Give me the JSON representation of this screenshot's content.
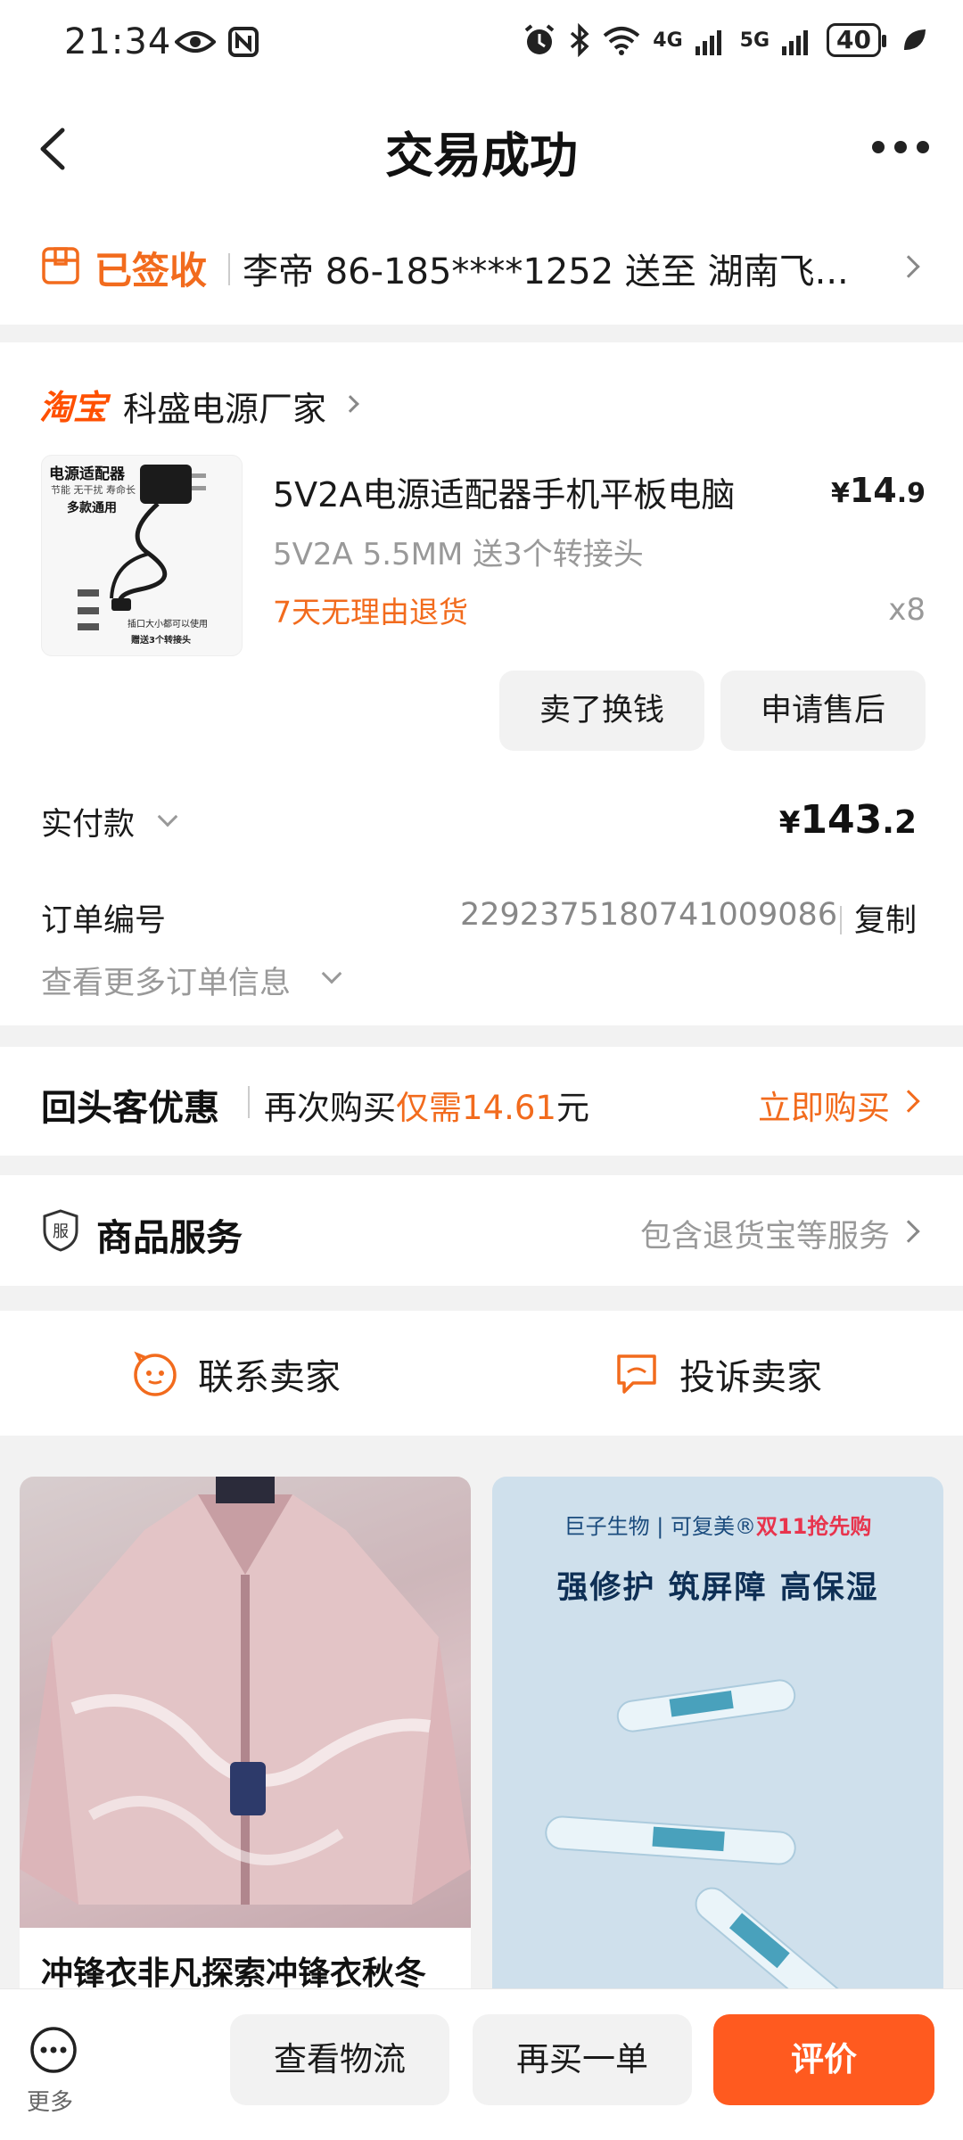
{
  "status_bar": {
    "time": "21:34",
    "battery": "40",
    "signal_4g": "4G",
    "signal_5g": "5G"
  },
  "header": {
    "title": "交易成功"
  },
  "delivery": {
    "status": "已签收",
    "address": "李帝 86-185****1252 送至 湖南飞..."
  },
  "order": {
    "platform_logo": "淘宝",
    "shop_name": "科盛电源厂家",
    "product": {
      "title": "5V2A电源适配器手机平板电脑",
      "sku": "5V2A 5.5MM 送3个转接头",
      "return_policy": "7天无理由退货",
      "price_symbol": "¥",
      "price_int": "14",
      "price_dec": ".9",
      "quantity": "x8",
      "image_title": "电源适配器",
      "image_sub1": "节能 无干扰 寿命长",
      "image_sub2": "多款通用",
      "image_note": "插口大小都可以使用",
      "image_note2": "赠送3个转接头"
    },
    "buttons": {
      "sell": "卖了换钱",
      "after_sale": "申请售后"
    },
    "payment_label": "实付款",
    "payment_symbol": "¥",
    "payment_int": "143",
    "payment_dec": ".2",
    "order_no_label": "订单编号",
    "order_no": "2292375180741009086",
    "copy_label": "复制",
    "more_info": "查看更多订单信息"
  },
  "returning": {
    "title": "回头客优惠",
    "text_pre": "再次购买",
    "text_highlight": "仅需14.61",
    "text_post": "元",
    "buy_now": "立即购买"
  },
  "service": {
    "icon_label": "服",
    "title": "商品服务",
    "desc": "包含退货宝等服务"
  },
  "contact": {
    "contact_seller": "联系卖家",
    "complain_seller": "投诉卖家"
  },
  "feed": [
    {
      "title": "冲锋衣非凡探索冲锋衣秋冬"
    },
    {
      "brand": "巨子生物 | 可复美®",
      "brand_highlight": "双11抢先购",
      "slogan": "强修护 筑屏障 高保湿"
    }
  ],
  "bottom_bar": {
    "more": "更多",
    "logistics": "查看物流",
    "buy_again": "再买一单",
    "review": "评价"
  },
  "colors": {
    "accent": "#f26b1d",
    "primary_button": "#ff5a1f",
    "background": "#f2f2f2"
  }
}
